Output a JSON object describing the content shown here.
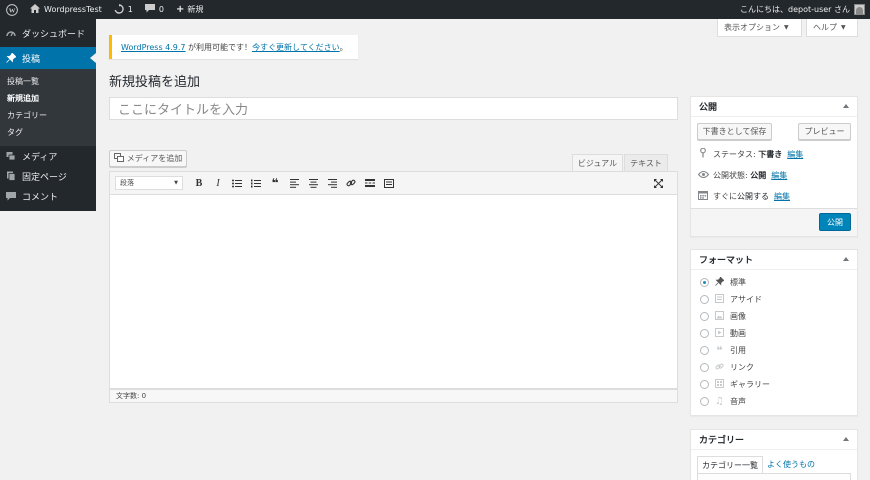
{
  "adminbar": {
    "site_name": "WordpressTest",
    "updates_count": "1",
    "comments_count": "0",
    "new_label": "新規",
    "greeting": "こんにちは、depot-user さん"
  },
  "menu": {
    "dashboard": "ダッシュボード",
    "posts": "投稿",
    "sub": [
      "投稿一覧",
      "新規追加",
      "カテゴリー",
      "タグ"
    ],
    "media": "メディア",
    "pages": "固定ページ",
    "comments": "コメント"
  },
  "screen": {
    "options_label": "表示オプション",
    "help_label": "ヘルプ"
  },
  "notice": {
    "version_link": "WordPress 4.9.7",
    "middle": " が利用可能です！",
    "update_link": "今すぐ更新してください",
    "end": "。"
  },
  "page_title": "新規投稿を追加",
  "title_placeholder": "ここにタイトルを入力",
  "editor": {
    "add_media": "メディアを追加",
    "tab_visual": "ビジュアル",
    "tab_text": "テキスト",
    "format_value": "段落",
    "word_count": "文字数: 0"
  },
  "publish": {
    "heading": "公開",
    "save_draft": "下書きとして保存",
    "preview": "プレビュー",
    "status_label": "ステータス: ",
    "status_value": "下書き",
    "visibility_label": "公開状態: ",
    "visibility_value": "公開",
    "schedule_label": "すぐに",
    "schedule_rest": "公開する",
    "edit": "編集",
    "publish_button": "公開"
  },
  "format": {
    "heading": "フォーマット",
    "options": [
      "標準",
      "アサイド",
      "画像",
      "動画",
      "引用",
      "リンク",
      "ギャラリー",
      "音声"
    ],
    "selected": "標準"
  },
  "category": {
    "heading": "カテゴリー",
    "tab_all": "カテゴリー一覧",
    "tab_popular": "よく使うもの"
  }
}
